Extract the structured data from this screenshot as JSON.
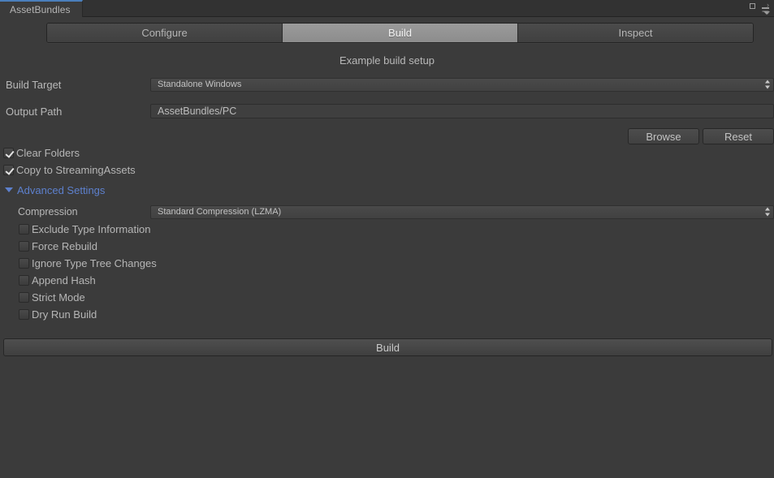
{
  "window": {
    "tab_label": "AssetBundles",
    "lock_icon": "lock-icon",
    "menu_icon": "menu-icon",
    "accent_color": "#4a7ebb",
    "background_color": "#3b3b3b"
  },
  "mode_tabs": [
    {
      "label": "Configure",
      "selected": false
    },
    {
      "label": "Build",
      "selected": true
    },
    {
      "label": "Inspect",
      "selected": false
    }
  ],
  "build_panel": {
    "title": "Example build setup",
    "build_target": {
      "label": "Build Target",
      "value": "Standalone Windows"
    },
    "output_path": {
      "label": "Output Path",
      "value": "AssetBundles/PC"
    },
    "buttons": {
      "browse": "Browse",
      "reset": "Reset"
    },
    "options": [
      {
        "label": "Clear Folders",
        "checked": true
      },
      {
        "label": "Copy to StreamingAssets",
        "checked": true
      }
    ],
    "advanced": {
      "label": "Advanced Settings",
      "expanded": true,
      "color": "#5d80cd",
      "compression": {
        "label": "Compression",
        "value": "Standard Compression (LZMA)"
      },
      "options": [
        {
          "label": "Exclude Type Information",
          "checked": false
        },
        {
          "label": "Force Rebuild",
          "checked": false
        },
        {
          "label": "Ignore Type Tree Changes",
          "checked": false
        },
        {
          "label": "Append Hash",
          "checked": false
        },
        {
          "label": "Strict Mode",
          "checked": false
        },
        {
          "label": "Dry Run Build",
          "checked": false
        }
      ]
    },
    "build_button_label": "Build"
  }
}
